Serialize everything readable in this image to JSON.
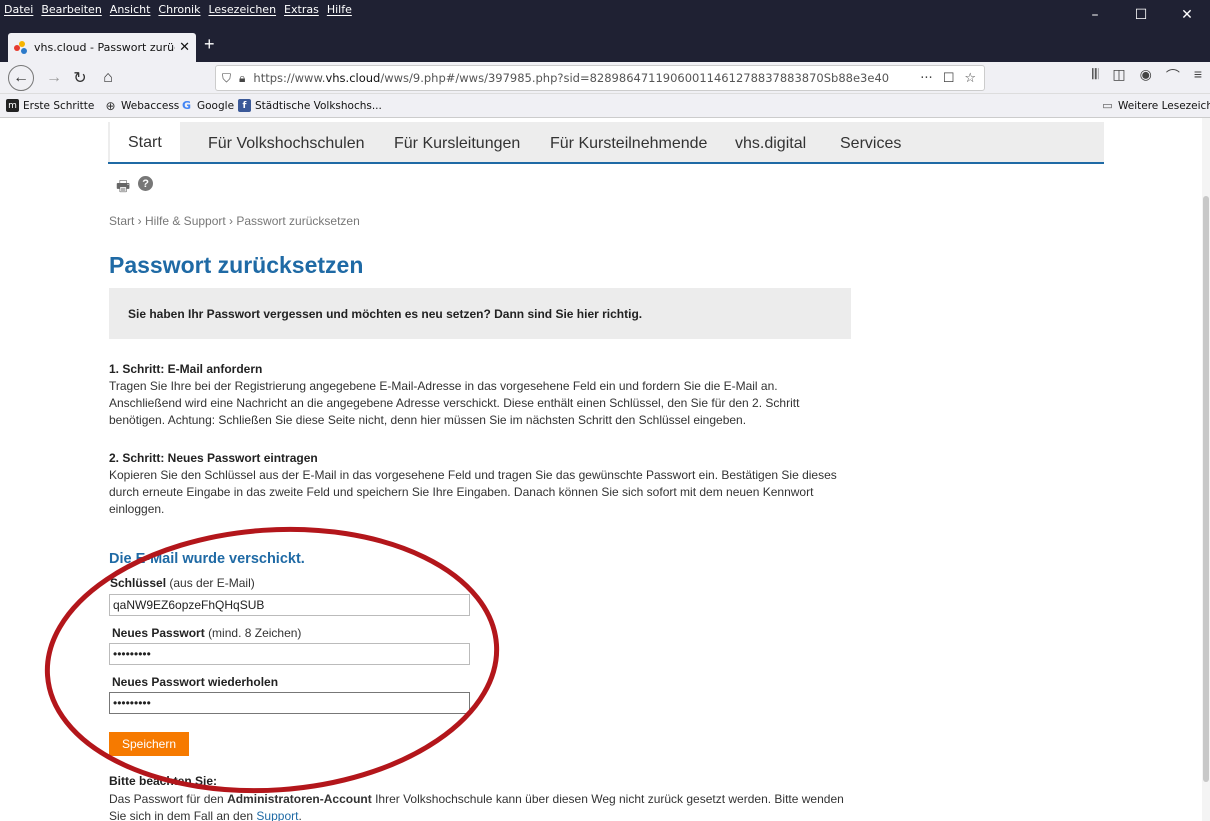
{
  "browser": {
    "menu": [
      "Datei",
      "Bearbeiten",
      "Ansicht",
      "Chronik",
      "Lesezeichen",
      "Extras",
      "Hilfe"
    ],
    "tab_title": "vhs.cloud - Passwort zurücksetz",
    "url_prefix": "https://www.",
    "url_domain": "vhs.cloud",
    "url_rest": "/wws/9.php#/wws/397985.php?sid=82898647119060011461278837883870Sb88e3e40",
    "bookmarks": [
      "Erste Schritte",
      "Webaccess",
      "Google",
      "Städtische Volkshochs..."
    ],
    "other_bookmarks": "Weitere Lesezeichen"
  },
  "site_nav": {
    "items": [
      "Start",
      "Für Volkshochschulen",
      "Für Kursleitungen",
      "Für Kursteilnehmende",
      "vhs.digital",
      "Services"
    ]
  },
  "breadcrumb": "Start  › Hilfe & Support  › Passwort zurücksetzen",
  "page_title": "Passwort zurücksetzen",
  "info": "Sie haben Ihr Passwort vergessen und möchten es neu setzen? Dann sind Sie hier richtig.",
  "step1": {
    "heading": "1. Schritt: E-Mail anfordern",
    "text": "Tragen Sie Ihre bei der Registrierung angegebene E-Mail-Adresse in das vorgesehene Feld ein und fordern Sie die E-Mail an. Anschließend wird eine Nachricht an die angegebene Adresse verschickt. Diese enthält einen Schlüssel, den Sie für den 2. Schritt benötigen. Achtung: Schließen Sie diese Seite nicht, denn hier müssen Sie im nächsten Schritt den Schlüssel eingeben."
  },
  "step2": {
    "heading": "2. Schritt: Neues Passwort eintragen",
    "text": "Kopieren Sie den Schlüssel aus der E-Mail in das vorgesehene Feld und tragen Sie das gewünschte Passwort ein. Bestätigen Sie dieses durch erneute Eingabe in das zweite Feld und speichern Sie Ihre Eingaben. Danach können Sie sich sofort mit dem neuen Kennwort einloggen."
  },
  "form": {
    "sent_title": "Die E-Mail wurde verschickt.",
    "key_label": "Schlüssel",
    "key_hint": "(aus der E-Mail)",
    "key_value": "qaNW9EZ6opzeFhQHqSUB",
    "pw_label": "Neues Passwort",
    "pw_hint": "(mind. 8 Zeichen)",
    "pw_value": "•••••••••",
    "pw2_label": "Neues Passwort wiederholen",
    "pw2_value": "•••••••••",
    "save_label": "Speichern"
  },
  "note": {
    "title": "Bitte beachten Sie:",
    "text_before": "Das Passwort für den ",
    "text_bold": "Administratoren-Account",
    "text_after": " Ihrer Volkshochschule kann über diesen Weg nicht zurück gesetzt werden. Bitte wenden Sie sich in dem Fall an den ",
    "link": "Support",
    "text_end": "."
  },
  "colors": {
    "accent": "#1f6aa5",
    "save_button": "#f67a00",
    "annotation_ellipse": "#b3161b"
  }
}
